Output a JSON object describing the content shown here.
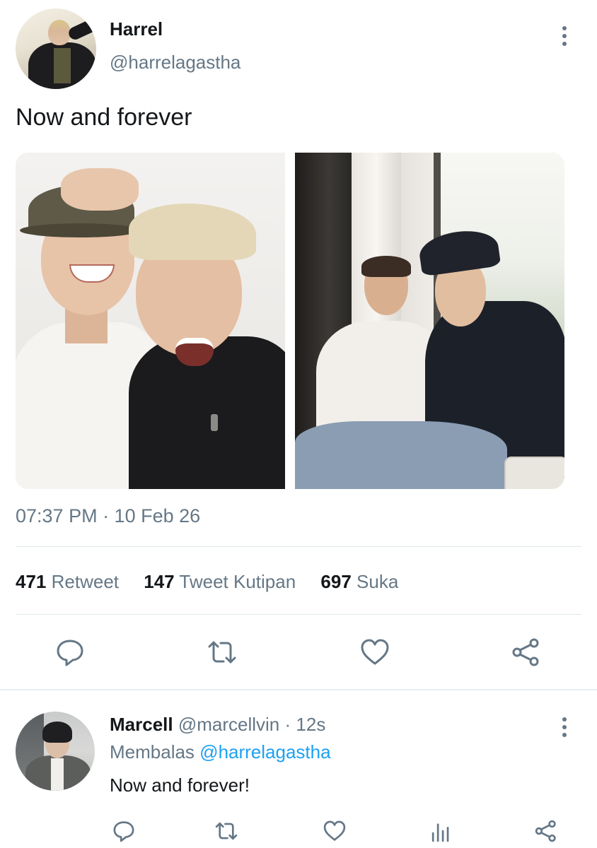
{
  "tweet": {
    "author_name": "Harrel",
    "author_handle": "@harrelagastha",
    "text": "Now and forever",
    "timestamp": "07:37 PM · 10 Feb 26",
    "stats": [
      {
        "count": "471",
        "label": "Retweet"
      },
      {
        "count": "147",
        "label": "Tweet Kutipan"
      },
      {
        "count": "697",
        "label": "Suka"
      }
    ],
    "actions": [
      "reply-icon",
      "retweet-icon",
      "like-icon",
      "share-icon"
    ]
  },
  "reply": {
    "author_name": "Marcell",
    "author_handle": "@marcellvin",
    "separator": "·",
    "time": "12s",
    "replying_label": "Membalas",
    "replying_to": "@harrelagastha",
    "text": "Now and forever!",
    "actions": [
      "reply-icon",
      "retweet-icon",
      "like-icon",
      "analytics-icon",
      "share-icon"
    ]
  },
  "colors": {
    "text": "#14171a",
    "secondary": "#657786",
    "link": "#1da1f2",
    "divider": "#e1e8ed"
  }
}
